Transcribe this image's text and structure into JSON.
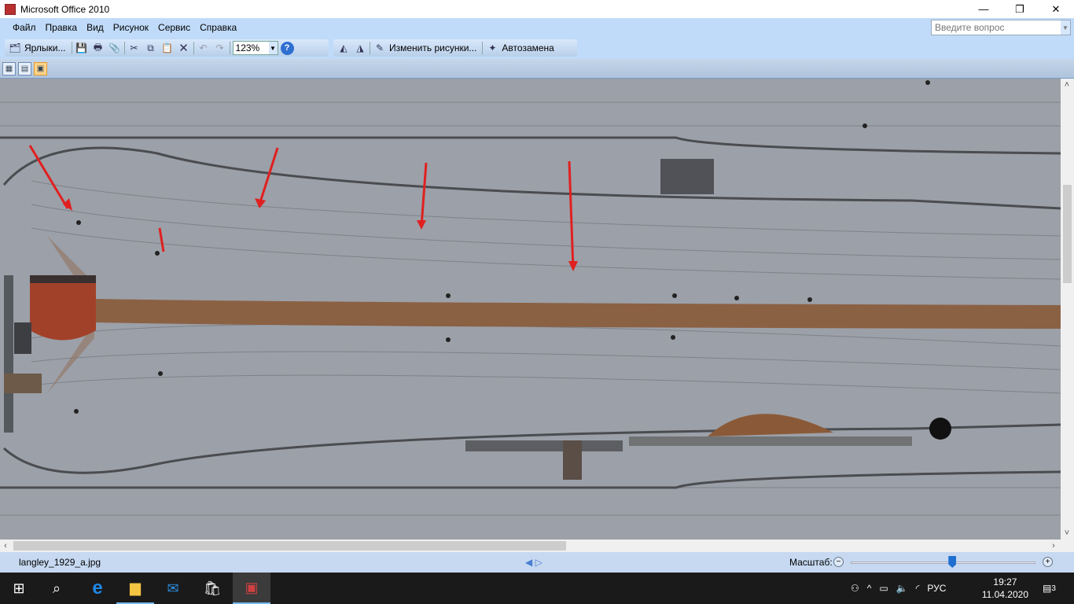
{
  "window": {
    "title": "Microsoft Office 2010",
    "minimize": "—",
    "restore": "❐",
    "close": "✕"
  },
  "menu": {
    "items": [
      "Файл",
      "Правка",
      "Вид",
      "Рисунок",
      "Сервис",
      "Справка"
    ],
    "ask_placeholder": "Введите вопрос"
  },
  "toolbar": {
    "shortcuts_label": "Ярлыки...",
    "zoom": "123%",
    "edit_pictures_label": "Изменить рисунки...",
    "autocorrect_label": "Автозамена"
  },
  "image": {
    "colors": {
      "hull": "#9a9ea6",
      "rust": "#8a5a38",
      "arrow": "#e02020"
    }
  },
  "status": {
    "filename": "langley_1929_a.jpg",
    "zoom_label": "Масштаб:",
    "zoom_level": 0.55
  },
  "taskbar": {
    "lang": "РУС",
    "time": "19:27",
    "date": "11.04.2020",
    "notifications": "3"
  }
}
